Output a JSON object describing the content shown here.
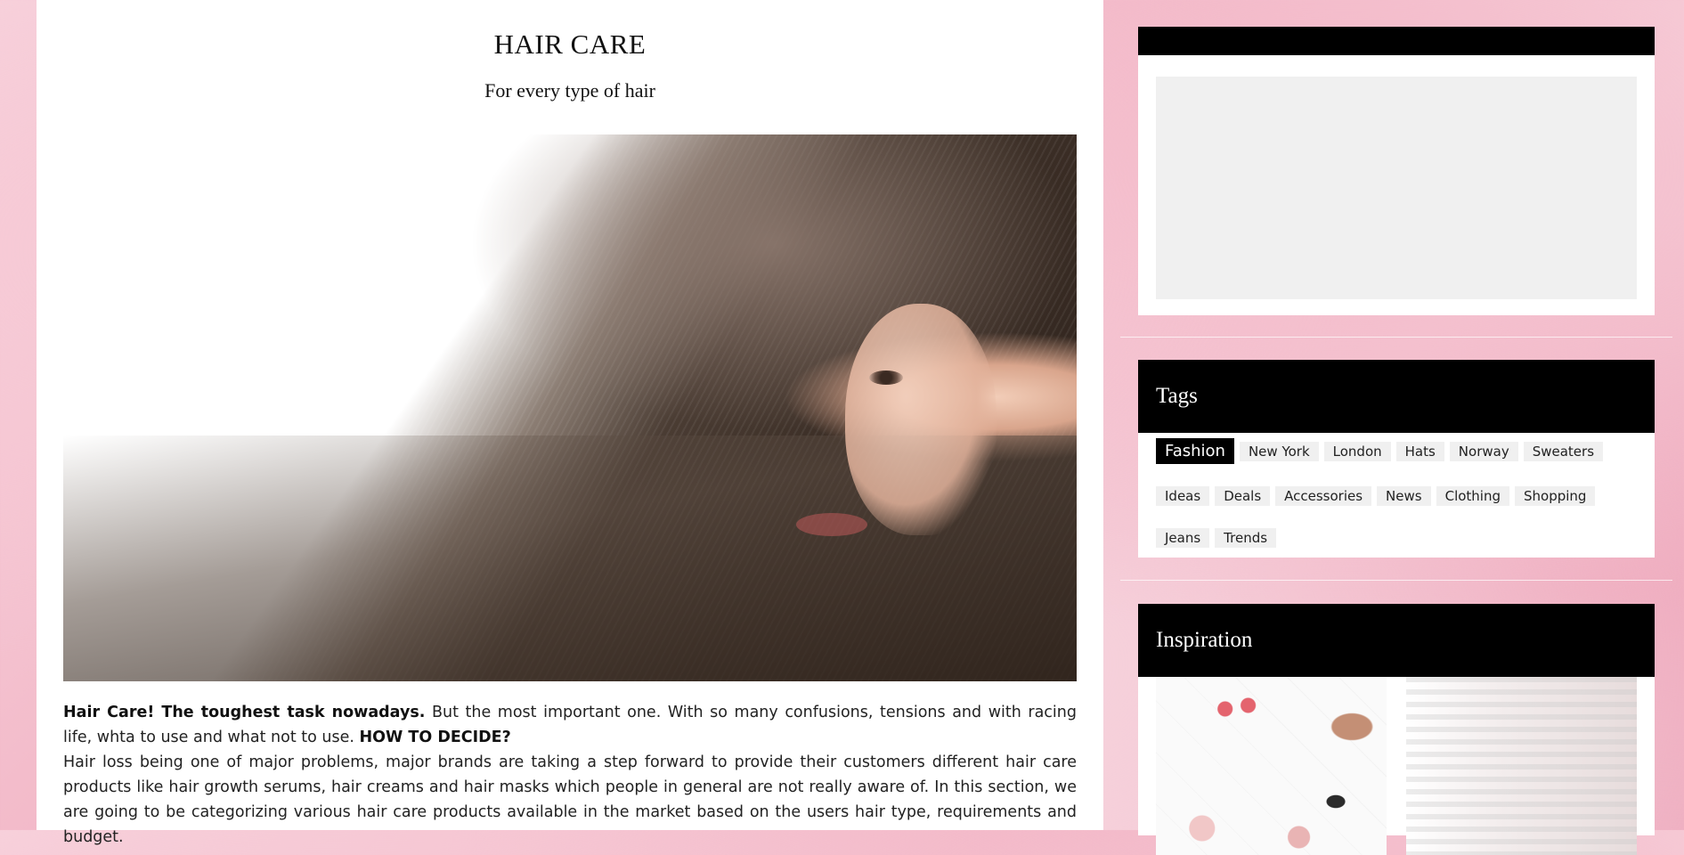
{
  "article": {
    "title": "HAIR CARE",
    "subtitle": "For every type of hair",
    "hero_image_alt": "Woman with long flowing dark hair",
    "intro_bold": "Hair Care! The toughest task nowadays.",
    "intro_text": " But the most important one. With so many confusions, tensions and with racing life, whta to use and what not to use. ",
    "intro_bold2": "HOW TO DECIDE?",
    "body_text": "Hair loss being one of major problems, major brands are taking a step forward to provide their customers different hair care products like hair growth serums, hair creams and hair masks which people in general are not really aware of. In this section, we are going to be categorizing various hair care products available in the market based on the users hair type, requirements and budget."
  },
  "sidebar": {
    "tags_title": "Tags",
    "tags": [
      "Fashion",
      "New York",
      "London",
      "Hats",
      "Norway",
      "Sweaters",
      "Ideas",
      "Deals",
      "Accessories",
      "News",
      "Clothing",
      "Shopping",
      "Jeans",
      "Trends"
    ],
    "active_tag": "Fashion",
    "inspiration_title": "Inspiration"
  },
  "colors": {
    "widget_header": "#000000",
    "page_background": "#f4c1cf",
    "ad_placeholder": "#f0f0f0"
  }
}
